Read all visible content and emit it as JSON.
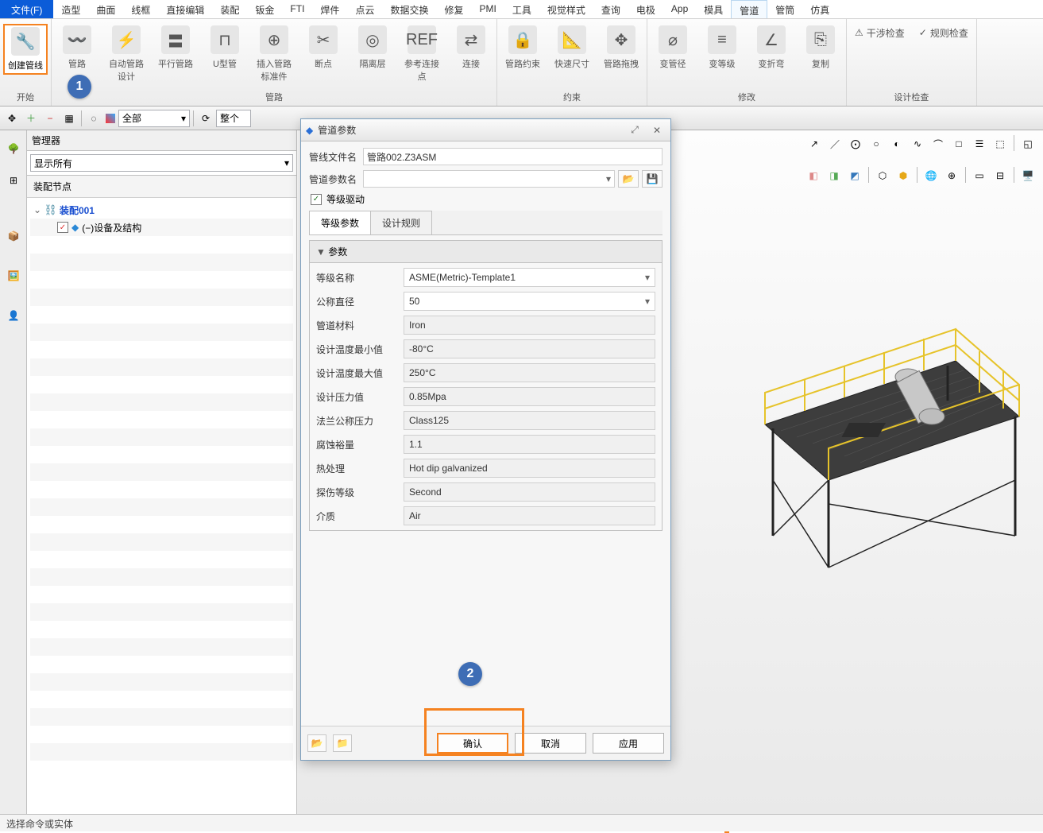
{
  "menu": {
    "file": "文件(F)",
    "items": [
      "造型",
      "曲面",
      "线框",
      "直接编辑",
      "装配",
      "钣金",
      "FTI",
      "焊件",
      "点云",
      "数据交换",
      "修复",
      "PMI",
      "工具",
      "视觉样式",
      "查询",
      "电极",
      "App",
      "模具",
      "管道",
      "管筒",
      "仿真"
    ]
  },
  "ribbon": {
    "groups": [
      {
        "label": "开始",
        "buttons": [
          {
            "name": "创建管线"
          }
        ]
      },
      {
        "label": "管路",
        "buttons": [
          {
            "name": "管路"
          },
          {
            "name": "自动管路设计"
          },
          {
            "name": "平行管路"
          },
          {
            "name": "U型管"
          },
          {
            "name": "插入管路标准件"
          },
          {
            "name": "断点"
          },
          {
            "name": "隔离层"
          },
          {
            "name": "参考连接点"
          },
          {
            "name": "连接"
          }
        ]
      },
      {
        "label": "约束",
        "buttons": [
          {
            "name": "管路约束"
          },
          {
            "name": "快速尺寸"
          },
          {
            "name": "管路拖拽"
          }
        ]
      },
      {
        "label": "修改",
        "buttons": [
          {
            "name": "变管径"
          },
          {
            "name": "变等级"
          },
          {
            "name": "变折弯"
          },
          {
            "name": "复制"
          }
        ]
      },
      {
        "label": "设计检查",
        "buttons": [
          {
            "name": "干涉检查"
          },
          {
            "name": "规则检查"
          }
        ]
      }
    ]
  },
  "steps": {
    "one": "1",
    "two": "2"
  },
  "toolbar": {
    "filter": "全部",
    "scope": "整个"
  },
  "manager": {
    "title": "管理器",
    "show_all": "显示所有",
    "section": "装配节点",
    "root": "装配001",
    "child": "(−)设备及结构"
  },
  "dialog": {
    "title": "管道参数",
    "file_label": "管线文件名",
    "file_value": "管路002.Z3ASM",
    "param_name_label": "管道参数名",
    "param_name_value": "",
    "level_driven": "等级驱动",
    "tabs": [
      "等级参数",
      "设计规则"
    ],
    "param_header": "参数",
    "rows": [
      {
        "label": "等级名称",
        "value": "ASME(Metric)-Template1",
        "combo": true
      },
      {
        "label": "公称直径",
        "value": "50",
        "combo": true
      },
      {
        "label": "管道材料",
        "value": "Iron"
      },
      {
        "label": "设计温度最小值",
        "value": "-80°C"
      },
      {
        "label": "设计温度最大值",
        "value": "250°C"
      },
      {
        "label": "设计压力值",
        "value": "0.85Mpa"
      },
      {
        "label": "法兰公称压力",
        "value": "Class125"
      },
      {
        "label": "腐蚀裕量",
        "value": "1.1"
      },
      {
        "label": "热处理",
        "value": "Hot dip galvanized"
      },
      {
        "label": "探伤等级",
        "value": "Second"
      },
      {
        "label": "介质",
        "value": "Air"
      }
    ],
    "buttons": {
      "ok": "确认",
      "cancel": "取消",
      "apply": "应用"
    }
  },
  "status": "选择命令或实体"
}
